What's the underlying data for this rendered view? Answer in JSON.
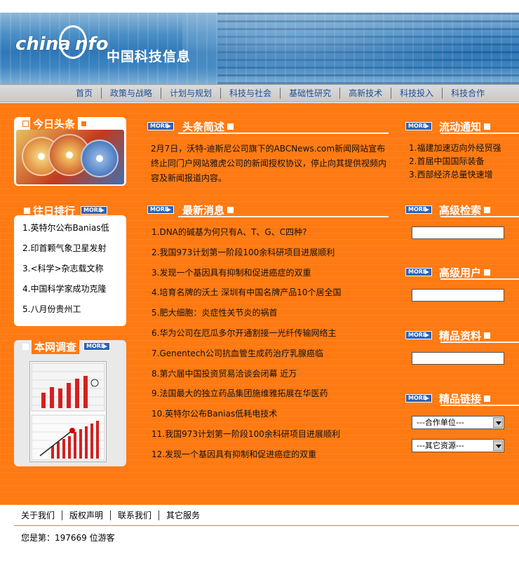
{
  "header": {
    "logo_latin": "china",
    "logo_latin2": "nfo",
    "logo_cn": "中国科技信息"
  },
  "nav": [
    "首页",
    "政策与战略",
    "计划与规划",
    "科技与社会",
    "基础性研究",
    "高新技术",
    "科技投入",
    "科技合作"
  ],
  "more_label": "MORE",
  "left": {
    "today_title": "今日头条",
    "rank_title": "往日排行",
    "rank_items": [
      "1.英特尔公布Banias低",
      "2.印首颗气象卫星发射",
      "3.<科学>杂志载文称",
      "4.中国科学家成功克隆",
      "5.八月份贵州工"
    ],
    "survey_title": "本网调查"
  },
  "middle": {
    "headline_title": "头条简述",
    "headline_text": "2月7日，沃特-迪斯尼公司旗下的ABCNews.com新闻网站宣布终止同门户网站雅虎公司的新闻授权协议，停止向其提供视频内容及新闻报道内容。",
    "news_title": "最新消息",
    "news_items": [
      "1.DNA的碱基为何只有A、T、G、C四种?",
      "2.我国973计划第一阶段100余科研项目进展顺利",
      "3.发现一个基因具有抑制和促进癌症的双重",
      "4.培育名牌的沃土  深圳有中国名牌产品10个居全国",
      "5.肥大细胞：炎症性关节炎的祸首",
      "6.华为公司在厄瓜多尔开通割接一光纤传输网络主",
      "7.Genentech公司抗血管生成药治疗乳腺癌临",
      "8.第六届中国投资贸易洽谈会闭幕  近万",
      "9.法国最大的独立药品集团施维雅拓展在华医药",
      "10.英特尔公布Banias低耗电技术",
      "11.我国973计划第一阶段100余科研项目进展顺利",
      "12.发现一个基因具有抑制和促进癌症的双重"
    ]
  },
  "right": {
    "notice_title": "流动通知",
    "notice_items": [
      "1.福建加速迈向外经贸强",
      "2.首届中国国际装备",
      "3.西部经济总量快速增"
    ],
    "search_title": "高级检索",
    "user_title": "高级用户",
    "resource_title": "精品资料",
    "links_title": "精品链接",
    "select1": "---合作单位---",
    "select2": "---其它资源---"
  },
  "footer": {
    "links": [
      "关于我们",
      "版权声明",
      "联系我们",
      "其它服务"
    ],
    "visitor": "您是第：197669 位游客"
  },
  "colors": {
    "orange": "#ff7a12",
    "nav_text": "#1d4f96",
    "more_blue": "#2d63b5"
  }
}
